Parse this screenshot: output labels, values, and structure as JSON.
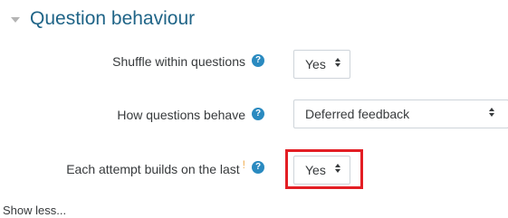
{
  "section": {
    "title": "Question behaviour",
    "collapse_icon": "caret-down-icon"
  },
  "fields": [
    {
      "label": "Shuffle within questions",
      "help_icon": "question-circle-icon",
      "help_glyph": "?",
      "value": "Yes"
    },
    {
      "label": "How questions behave",
      "help_icon": "question-circle-icon",
      "help_glyph": "?",
      "value": "Deferred feedback"
    },
    {
      "label": "Each attempt builds on the last",
      "warning_mark": "!",
      "help_icon": "question-circle-icon",
      "help_glyph": "?",
      "value": "Yes"
    }
  ],
  "show_less": "Show less...",
  "colors": {
    "section_title": "#1f6487",
    "help_icon": "#2a8ac0",
    "warning_mark": "#f0ad4e",
    "highlight": "#e31e24"
  }
}
